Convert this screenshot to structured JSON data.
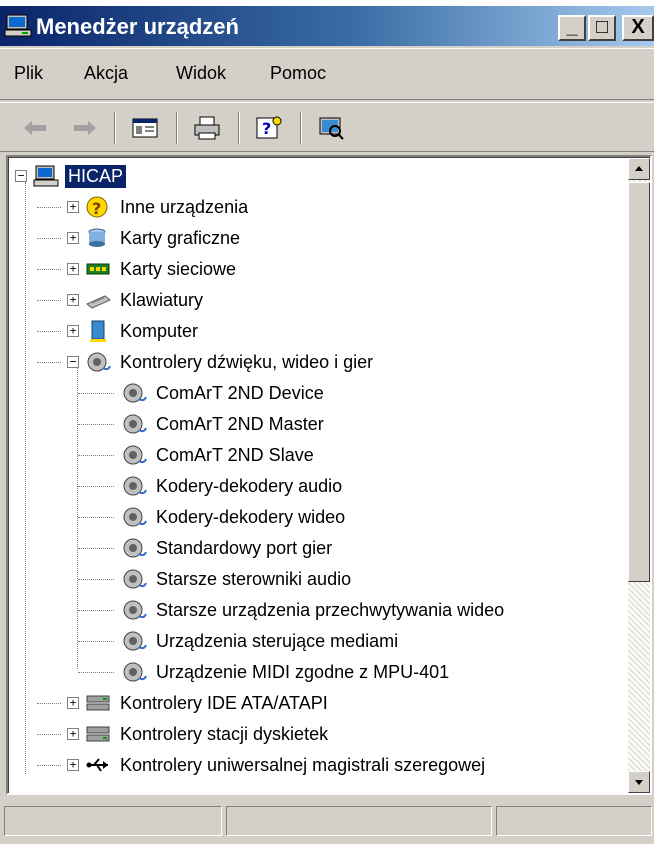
{
  "window": {
    "title": "Menedżer urządzeń"
  },
  "title_buttons": {
    "minimize": "_",
    "maximize": "□",
    "close": "X"
  },
  "menu": [
    "Plik",
    "Akcja",
    "Widok",
    "Pomoc"
  ],
  "toolbar": [
    "back-arrow-icon",
    "forward-arrow-icon",
    "properties-icon",
    "print-icon",
    "help-icon",
    "scan-hardware-icon"
  ],
  "tree": {
    "root": "HICAP",
    "items": [
      {
        "label": "Inne urządzenia",
        "icon": "unknown-device-icon",
        "expanded": false
      },
      {
        "label": "Karty graficzne",
        "icon": "display-adapter-icon",
        "expanded": false
      },
      {
        "label": "Karty sieciowe",
        "icon": "network-adapter-icon",
        "expanded": false
      },
      {
        "label": "Klawiatury",
        "icon": "keyboard-icon",
        "expanded": false
      },
      {
        "label": "Komputer",
        "icon": "computer-icon",
        "expanded": false
      },
      {
        "label": "Kontrolery dźwięku, wideo i gier",
        "icon": "sound-icon",
        "expanded": true
      },
      {
        "label": "Kontrolery IDE ATA/ATAPI",
        "icon": "ide-controller-icon",
        "expanded": false
      },
      {
        "label": "Kontrolery stacji dyskietek",
        "icon": "floppy-controller-icon",
        "expanded": false
      },
      {
        "label": "Kontrolery uniwersalnej magistrali szeregowej",
        "icon": "usb-icon",
        "expanded": false
      }
    ],
    "children": [
      "ComArT 2ND Device",
      "ComArT 2ND Master",
      "ComArT 2ND Slave",
      "Kodery-dekodery audio",
      "Kodery-dekodery wideo",
      "Standardowy port gier",
      "Starsze sterowniki audio",
      "Starsze urządzenia przechwytywania wideo",
      "Urządzenia sterujące mediami",
      "Urządzenie MIDI zgodne z MPU-401"
    ]
  },
  "colors": {
    "titlebar": "#0a246a",
    "selection": "#0a246a",
    "face": "#d4d0c8"
  }
}
